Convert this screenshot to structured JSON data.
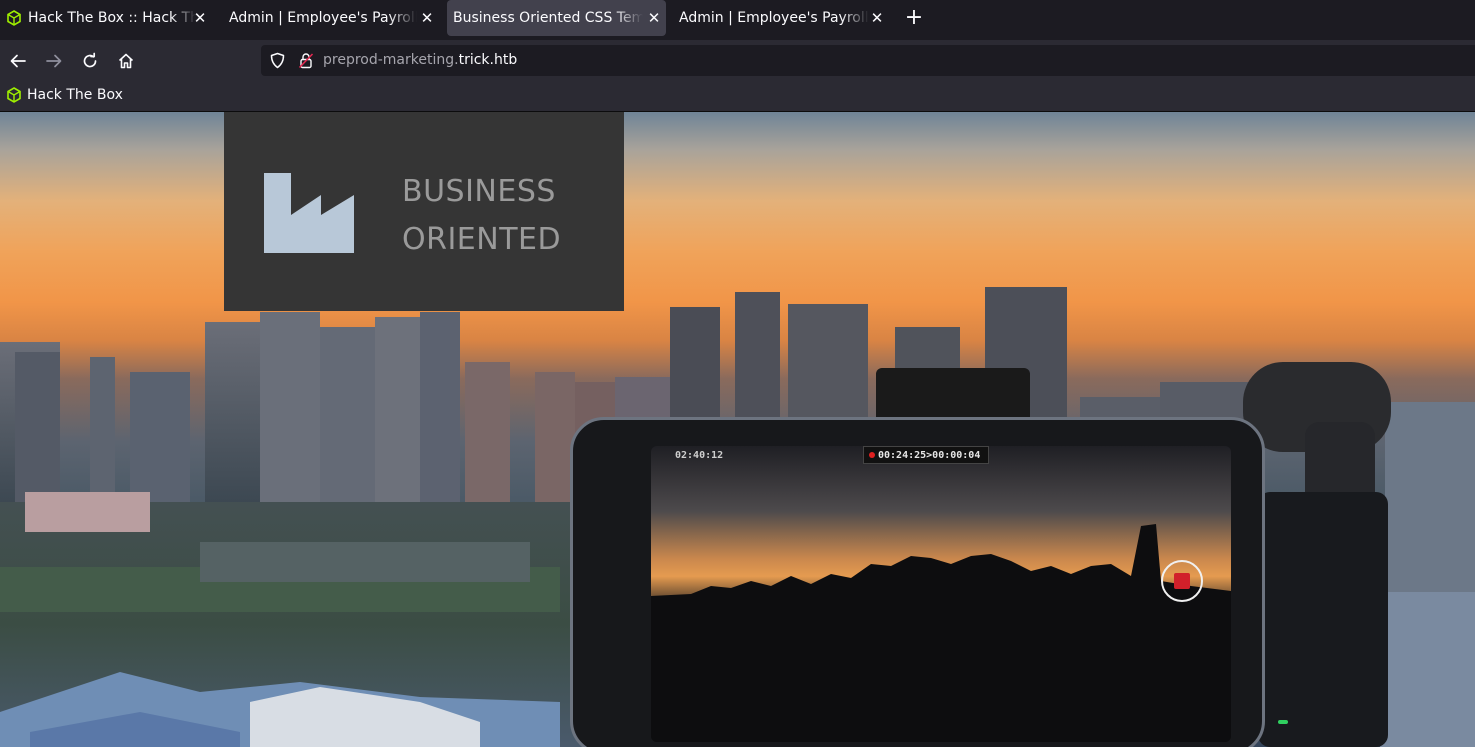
{
  "tabs": [
    {
      "title": "Hack The Box :: Hack The Box",
      "favicon": "htb-cube-icon",
      "active": false
    },
    {
      "title": "Admin | Employee's Payroll Management System",
      "favicon": "",
      "active": false
    },
    {
      "title": "Business Oriented CSS Template",
      "favicon": "",
      "active": true
    },
    {
      "title": "Admin | Employee's Payroll Management System",
      "favicon": "",
      "active": false
    }
  ],
  "urlbar": {
    "url_prefix": "preprod-marketing.",
    "url_host": "trick.htb"
  },
  "bookmarks": [
    {
      "label": "Hack The Box",
      "favicon": "htb-cube-icon"
    }
  ],
  "site": {
    "logo_line1": "BUSINESS",
    "logo_line2": "ORIENTED"
  },
  "hero_photo": {
    "phone_battery": "02:40:12",
    "phone_rec_time": "00:24:25>00:00:04"
  },
  "colors": {
    "htb_green": "#9fef00",
    "logo_icon": "#b8c8d8",
    "logo_box": "#353535",
    "record_red": "#d1202a"
  }
}
